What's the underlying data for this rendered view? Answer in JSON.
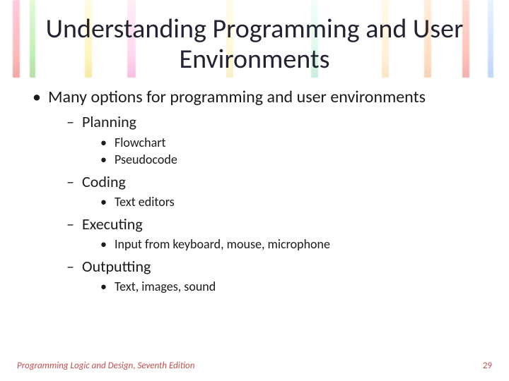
{
  "title": "Understanding Programming and User Environments",
  "bullets": {
    "main": "Many options for programming and user environments",
    "sections": [
      {
        "label": "Planning",
        "items": [
          "Flowchart",
          "Pseudocode"
        ]
      },
      {
        "label": "Coding",
        "items": [
          "Text editors"
        ]
      },
      {
        "label": "Executing",
        "items": [
          "Input from keyboard, mouse, microphone"
        ]
      },
      {
        "label": "Outputting",
        "items": [
          "Text, images, sound"
        ]
      }
    ]
  },
  "footer": {
    "book": "Programming Logic and Design, Seventh Edition",
    "page": "29"
  }
}
